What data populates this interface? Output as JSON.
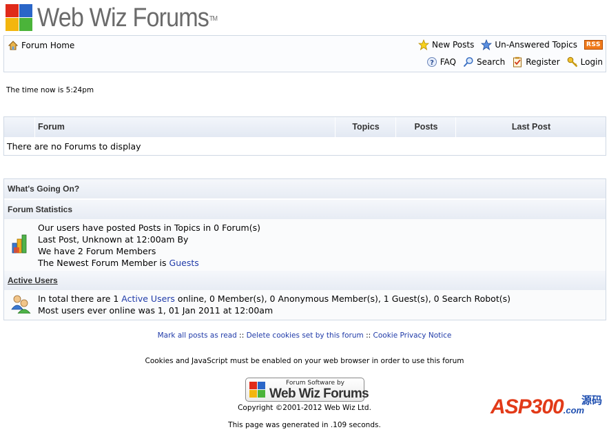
{
  "logo": {
    "text": "Web Wiz Forums",
    "tm": "TM"
  },
  "nav": {
    "forum_home": "Forum Home",
    "new_posts": "New Posts",
    "unanswered": "Un-Answered Topics",
    "rss": "RSS",
    "faq": "FAQ",
    "search": "Search",
    "register": "Register",
    "login": "Login"
  },
  "time_text": "The time now is 5:24pm",
  "forum_table": {
    "headers": {
      "forum": "Forum",
      "topics": "Topics",
      "posts": "Posts",
      "last_post": "Last Post"
    },
    "empty_text": "There are no Forums to display"
  },
  "whats_going_on": {
    "title": "What's Going On?",
    "stats_title": "Forum Statistics",
    "stats_line1": "Our users have posted Posts in Topics in 0 Forum(s)",
    "stats_line2": "Last Post, Unknown at 12:00am By",
    "stats_line3": "We have 2 Forum Members",
    "stats_line4_pre": "The Newest Forum Member is ",
    "stats_line4_link": "Guests",
    "active_title": "Active Users",
    "active_pre": "In total there are 1 ",
    "active_link": "Active Users",
    "active_post": " online, 0 Member(s), 0 Anonymous Member(s), 1 Guest(s), 0 Search Robot(s)",
    "active_line2": "Most users ever online was 1, 01 Jan 2011 at 12:00am"
  },
  "footer": {
    "mark_read": "Mark all posts as read",
    "sep": " :: ",
    "delete_cookies": "Delete cookies set by this forum",
    "cookie_notice": "Cookie Privacy Notice",
    "cookies_msg": "Cookies and JavaScript must be enabled on your web browser in order to use this forum",
    "badge_small": "Forum Software by",
    "badge_big": "Web Wiz Forums",
    "copyright": "Copyright ©2001-2012 Web Wiz Ltd.",
    "generated": "This page was generated in .109 seconds."
  },
  "watermark": {
    "main": "ASP300",
    "sub": ".com",
    "cn": "源码"
  },
  "colors": {
    "link": "#1f3aa8",
    "border": "#cfd8e4",
    "header_bg": "#e3e9f3"
  }
}
